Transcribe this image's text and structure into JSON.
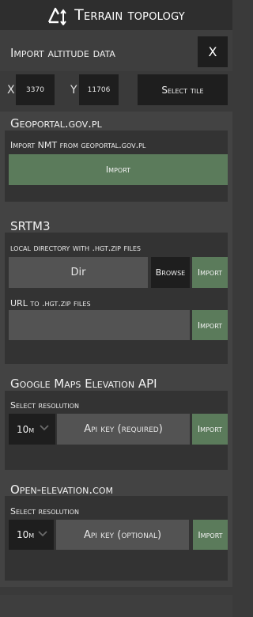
{
  "window": {
    "title": "Terrain topology",
    "logo_icon": "terrain-logo-icon"
  },
  "import": {
    "header": "Import altitude data",
    "close_label": "X",
    "x_label": "X",
    "x_value": "3370",
    "y_label": "Y",
    "y_value": "11706",
    "select_tile_label": "Select tile"
  },
  "geoportal": {
    "title": "Geoportal.gov.pl",
    "sub_label": "Import NMT from geoportal.gov.pl",
    "import_label": "Import"
  },
  "srtm": {
    "title": "SRTM3",
    "dir_label": "local directory with .hgt.zip files",
    "dir_value": "Dir",
    "browse_label": "Browse",
    "import_label": "Import",
    "url_label": "URL to .hgt.zip files",
    "url_value": "",
    "url_import_label": "Import"
  },
  "google": {
    "title": "Google Maps Elevation API",
    "resolution_label": "Select resolution",
    "resolution_value": "10m",
    "api_key_placeholder": "Api key (required)",
    "import_label": "Import"
  },
  "open_elevation": {
    "title": "Open-elevation.com",
    "resolution_label": "Select resolution",
    "resolution_value": "10m",
    "api_key_placeholder": "Api key (optional)",
    "import_label": "Import"
  },
  "colors": {
    "accent_green": "#5b7b5b",
    "dark_button": "#1e1e1e",
    "panel": "#333333",
    "band": "#434343"
  }
}
